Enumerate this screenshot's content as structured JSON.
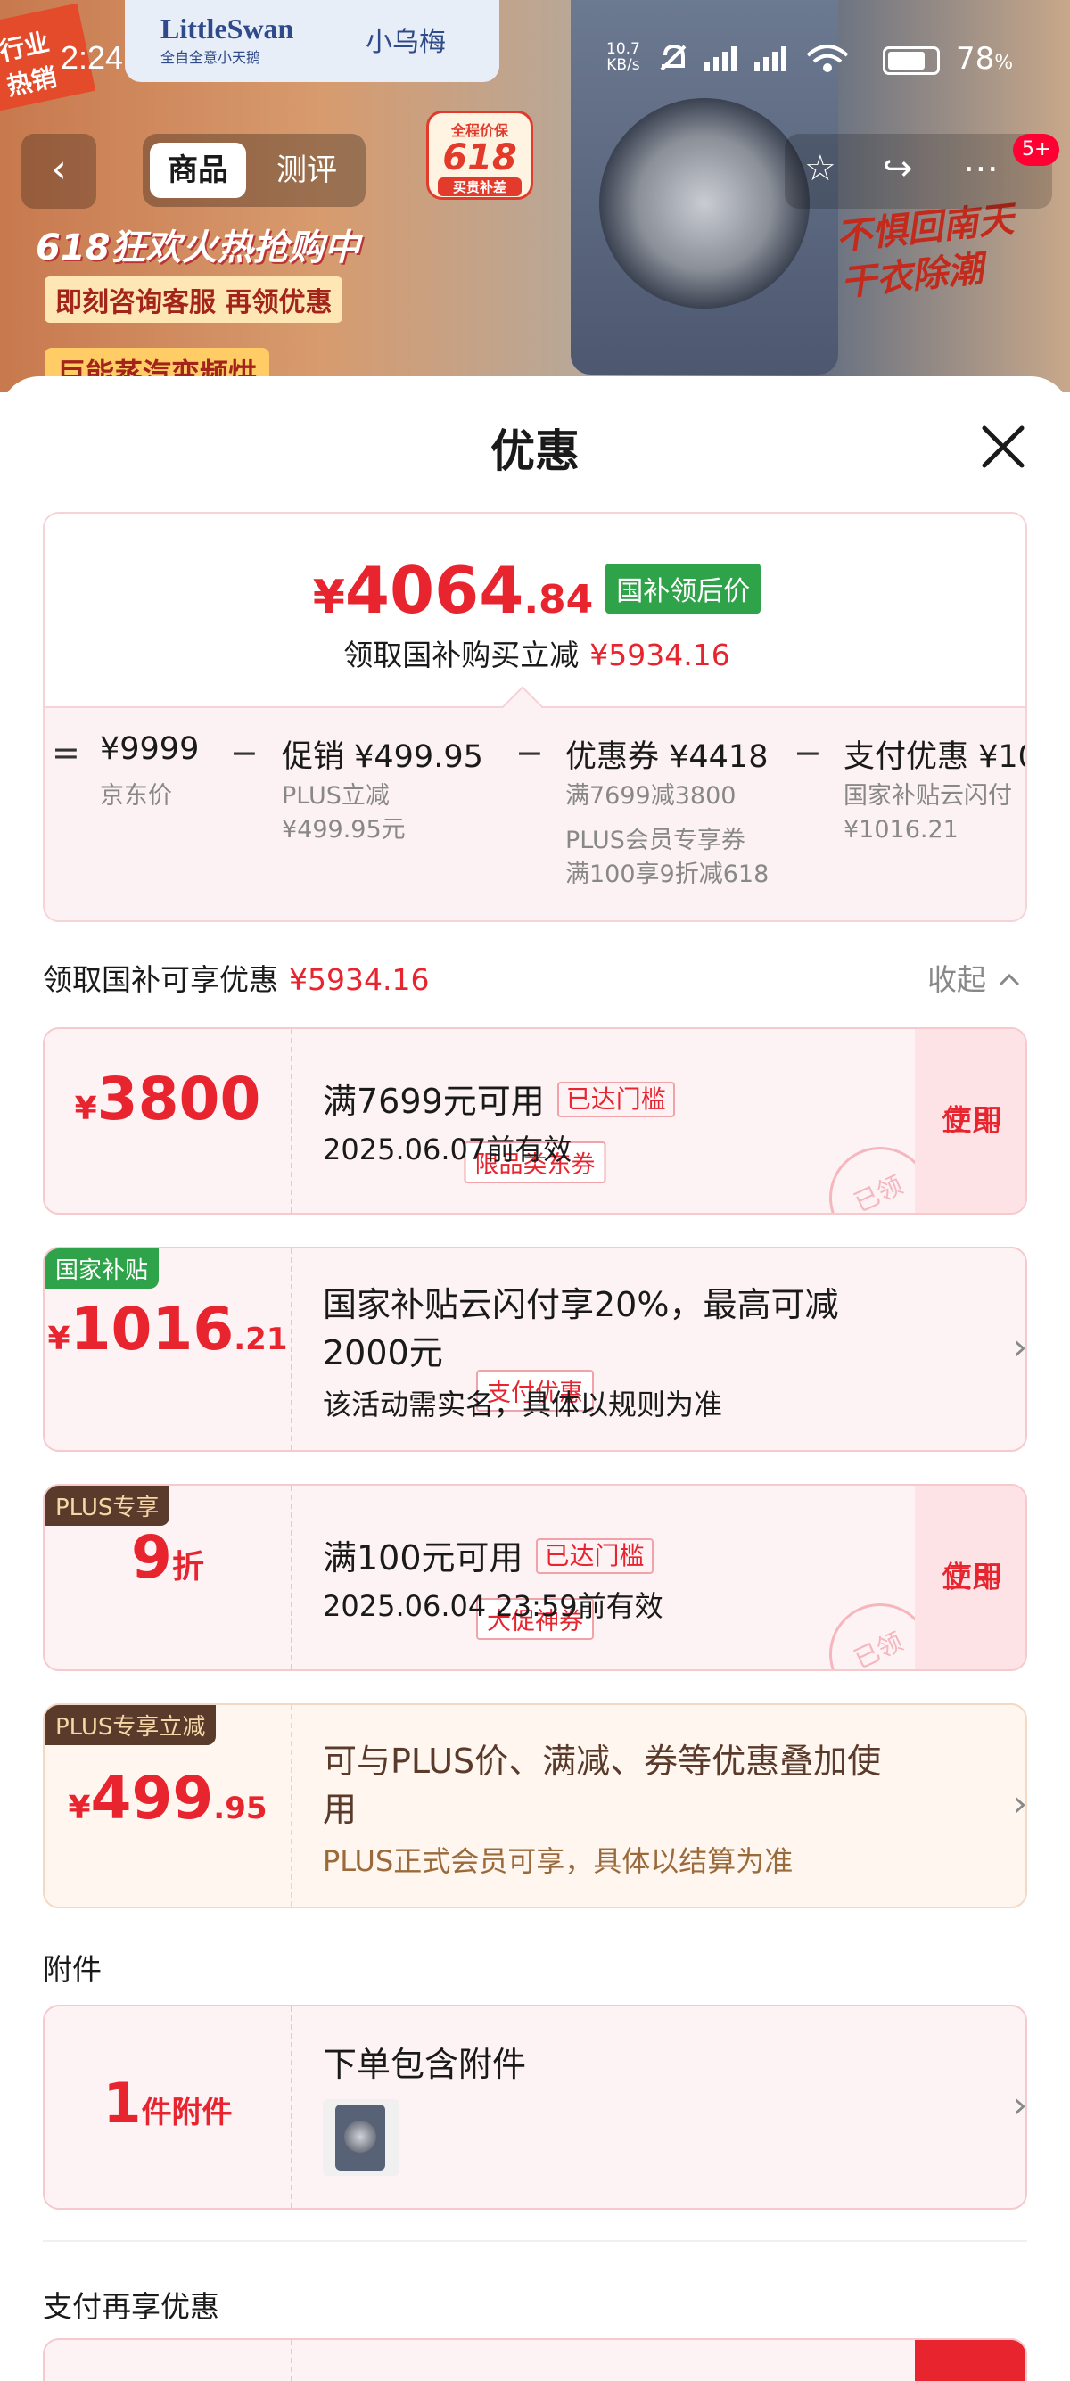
{
  "status_bar": {
    "time": "2:24",
    "speed_value": "10.7",
    "speed_unit": "KB/s",
    "battery": "78",
    "battery_unit": "%",
    "battery_level": 0.78
  },
  "hero": {
    "brand": "LittleSwan",
    "brand_sub": "全自全意小天鹅",
    "brand_cn": "小乌梅",
    "corner_tag": "行业热销",
    "sale_title": "618狂欢火热抢购中",
    "sale_sub": "即刻咨询客服 再领优惠",
    "sale_extra": "巨能蒸汽变频烘",
    "badge_top": "全程价保",
    "badge_num": "618",
    "badge_bottom": "买贵补差",
    "slogan_line1": "不惧回南天",
    "slogan_line2": "干衣除潮"
  },
  "nav": {
    "back_icon": "‹",
    "tabs": [
      "商品",
      "测评"
    ],
    "active_tab": 0,
    "message_badge": "5+"
  },
  "sheet": {
    "title": "优惠"
  },
  "summary": {
    "price_symbol": "¥",
    "price_int": "4064",
    "price_dec": ".84",
    "price_tag": "国补领后价",
    "save_text": "领取国补购买立减",
    "save_amount": "¥5934.16",
    "breakdown": [
      {
        "op": "=",
        "main": "¥9999",
        "sub": [
          "京东价"
        ]
      },
      {
        "op": "−",
        "main": "促销 ¥499.95",
        "sub": [
          "PLUS立减",
          "¥499.95元"
        ]
      },
      {
        "op": "−",
        "main": "优惠券 ¥4418",
        "sub": [
          "满7699减3800",
          "PLUS会员专享券",
          "满100享9折减618"
        ]
      },
      {
        "op": "−",
        "main": "支付优惠 ¥1016.21",
        "sub": [
          "国家补贴云闪付",
          "¥1016.21"
        ]
      }
    ]
  },
  "section1": {
    "label": "领取国补可享优惠",
    "amount": "¥5934.16",
    "collapse_label": "收起"
  },
  "coupons": [
    {
      "amount_symbol": "¥",
      "amount_int": "3800",
      "amount_dec": "",
      "label": "限品类东券",
      "title": "满7699元可用",
      "reach_tag": "已达门槛",
      "sub": "2025.06.07前有效",
      "action": "立即使用",
      "action_line1": "立即",
      "action_line2": "使用",
      "stamp": "已领"
    },
    {
      "corner": "国家补贴",
      "amount_symbol": "¥",
      "amount_int": "1016",
      "amount_dec": ".21",
      "label": "支付优惠",
      "title_line1": "国家补贴云闪付享20%，最高可减",
      "title_line2": "2000元",
      "sub": "该活动需实名，具体以规则为准"
    },
    {
      "corner": "PLUS专享",
      "amount_int": "9",
      "amount_unit": "折",
      "label": "大促神券",
      "title": "满100元可用",
      "reach_tag": "已达门槛",
      "sub": "2025.06.04 23:59前有效",
      "action_line1": "立即",
      "action_line2": "使用",
      "stamp": "已领"
    },
    {
      "corner": "PLUS专享立减",
      "amount_symbol": "¥",
      "amount_int": "499",
      "amount_dec": ".95",
      "title_line1": "可与PLUS价、满减、券等优惠叠加使",
      "title_line2": "用",
      "sub": "PLUS正式会员可享，具体以结算为准"
    }
  ],
  "accessory_section": {
    "label": "附件",
    "count": "1",
    "count_unit": "件附件",
    "title": "下单包含附件"
  },
  "pay_section": {
    "label": "支付再享优惠"
  },
  "colors": {
    "accent_red": "#e8242f",
    "green_tag": "#2fa34a",
    "plus_brown": "#5a3a2a",
    "card_bg": "#fdf3f4"
  },
  "icons": {
    "close": "close-icon",
    "back": "back-arrow-icon",
    "star": "star-icon",
    "share": "share-icon",
    "more": "more-icon",
    "chevron": "chevron-right-icon",
    "collapse": "chevron-up-icon"
  }
}
